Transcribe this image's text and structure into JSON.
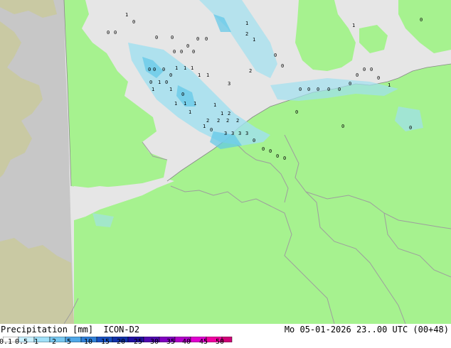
{
  "map": {
    "precip_values": [
      "0",
      "0",
      "1",
      "0",
      "0",
      "0",
      "0",
      "0",
      "0",
      "0",
      "0",
      "0",
      "0",
      "0",
      "0",
      "0",
      "0",
      "0",
      "1",
      "1",
      "1",
      "1",
      "1",
      "1",
      "1",
      "1",
      "1",
      "1",
      "1",
      "1",
      "1",
      "2",
      "2",
      "2",
      "2",
      "2",
      "2",
      "2",
      "3",
      "3",
      "3",
      "3",
      "3",
      "0",
      "0",
      "0",
      "0",
      "0",
      "0",
      "1",
      "1",
      "0",
      "0",
      "0",
      "0",
      "0",
      "0",
      "0",
      "0",
      "0",
      "0",
      "0",
      "1",
      "1",
      "1",
      "1",
      "0",
      "0",
      "0",
      "0",
      "0",
      "0"
    ],
    "colors": {
      "land": "#a6f28f",
      "sea": "#e6e6e6",
      "outside_domain": "#c7c7c7",
      "outside_land": "#c9c9a3",
      "border": "#9e9e9e",
      "rain_light": "#a0e0f0",
      "rain_medium": "#5fc8e8"
    }
  },
  "footer": {
    "title_left": "Precipitation [mm]  ICON-D2",
    "title_right": "Mo 05-01-2026 23..00 UTC (00+48)",
    "scale_labels": [
      "0.1",
      "0.5",
      "1",
      "2",
      "5",
      "10",
      "15",
      "20",
      "25",
      "30",
      "35",
      "40",
      "45",
      "50"
    ],
    "scale_colors": [
      "#ffffff",
      "#c8f0ff",
      "#a0e0f8",
      "#78c8f0",
      "#50a8e8",
      "#3080d8",
      "#1850c0",
      "#1030a8",
      "#2010a0",
      "#5008b0",
      "#8000c0",
      "#b000c8",
      "#e000d0",
      "#f000a0",
      "#d00078"
    ]
  }
}
